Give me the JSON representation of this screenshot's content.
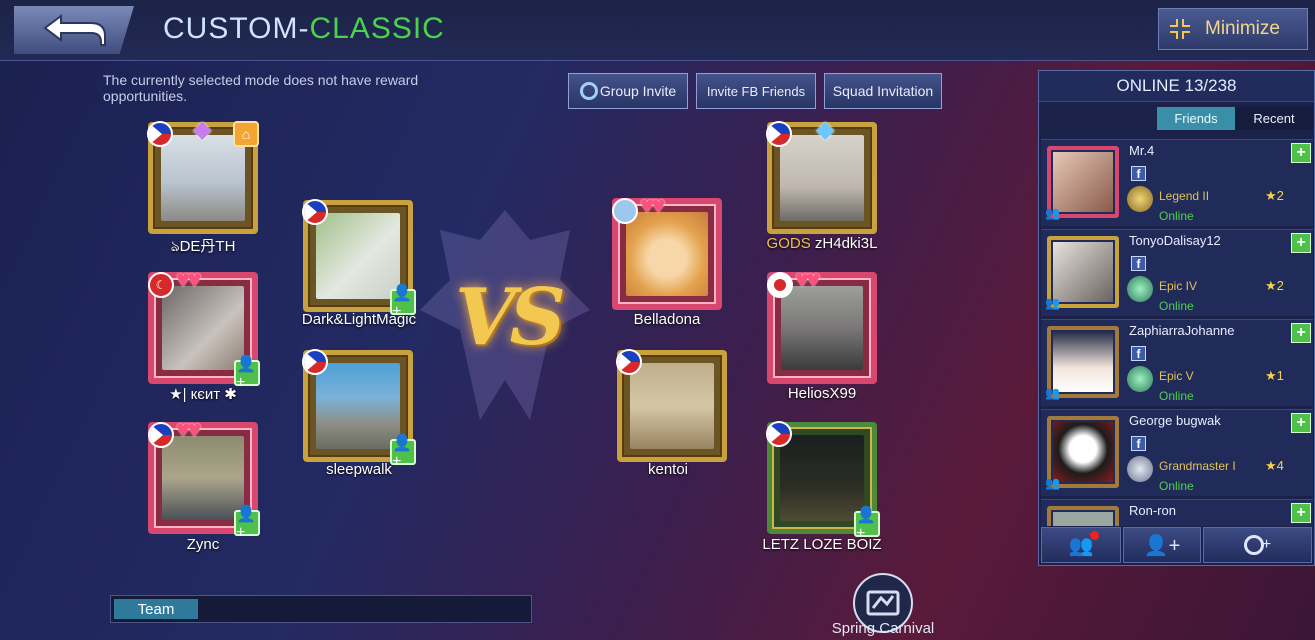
{
  "header": {
    "title_part1": "CUSTOM-",
    "title_part2": "CLASSIC",
    "back_icon": "back-arrow-icon",
    "minimize_label": "Minimize",
    "minimize_icon": "collapse-arrows-icon"
  },
  "notice": "The currently selected mode does not have reward opportunities.",
  "invite_buttons": {
    "group_invite": "Group Invite",
    "invite_fb": "Invite FB Friends",
    "squad": "Squad Invitation"
  },
  "team_left": [
    {
      "name": "ঌDE丹TH",
      "flag": "PH"
    },
    {
      "name": "Dark&LightMagic",
      "flag": "PH"
    },
    {
      "name": "★| кєит ✱",
      "flag": "TR"
    },
    {
      "name": "sleepwalk",
      "flag": "PH"
    },
    {
      "name": "Zync",
      "flag": "PH"
    }
  ],
  "team_right": [
    {
      "name_prefix": "GODS",
      "name": "zH4dki3L",
      "flag": "PH"
    },
    {
      "name": "Belladona",
      "flag": ""
    },
    {
      "name": "HeliosX99",
      "flag": "JP"
    },
    {
      "name": "kentoi",
      "flag": "PH"
    },
    {
      "name": "LETZ LOZE BOIZ",
      "flag": "PH"
    }
  ],
  "vs_label": "VS",
  "team_bar": {
    "tab": "Team"
  },
  "event": {
    "label": "Spring Carnival"
  },
  "friends_panel": {
    "title": "ONLINE 13/238",
    "tabs": [
      "Friends",
      "Recent"
    ],
    "friends": [
      {
        "name": "Mr.4",
        "rank": "Legend II",
        "stars": "2",
        "status": "Online"
      },
      {
        "name": "TonyoDalisay12",
        "rank": "Epic IV",
        "stars": "2",
        "status": "Online"
      },
      {
        "name": "ZaphiarraJohanne",
        "rank": "Epic V",
        "stars": "1",
        "status": "Online"
      },
      {
        "name": "George bugwak",
        "rank": "Grandmaster I",
        "stars": "4",
        "status": "Online"
      },
      {
        "name": "Ron-ron"
      }
    ],
    "fb_glyph": "f",
    "footer_icons": [
      "friend-requests-icon",
      "add-friend-icon",
      "add-group-icon"
    ]
  },
  "colors": {
    "title_green": "#4ad34a",
    "online_green": "#4ed04e",
    "rank_gold": "#e0c256"
  }
}
